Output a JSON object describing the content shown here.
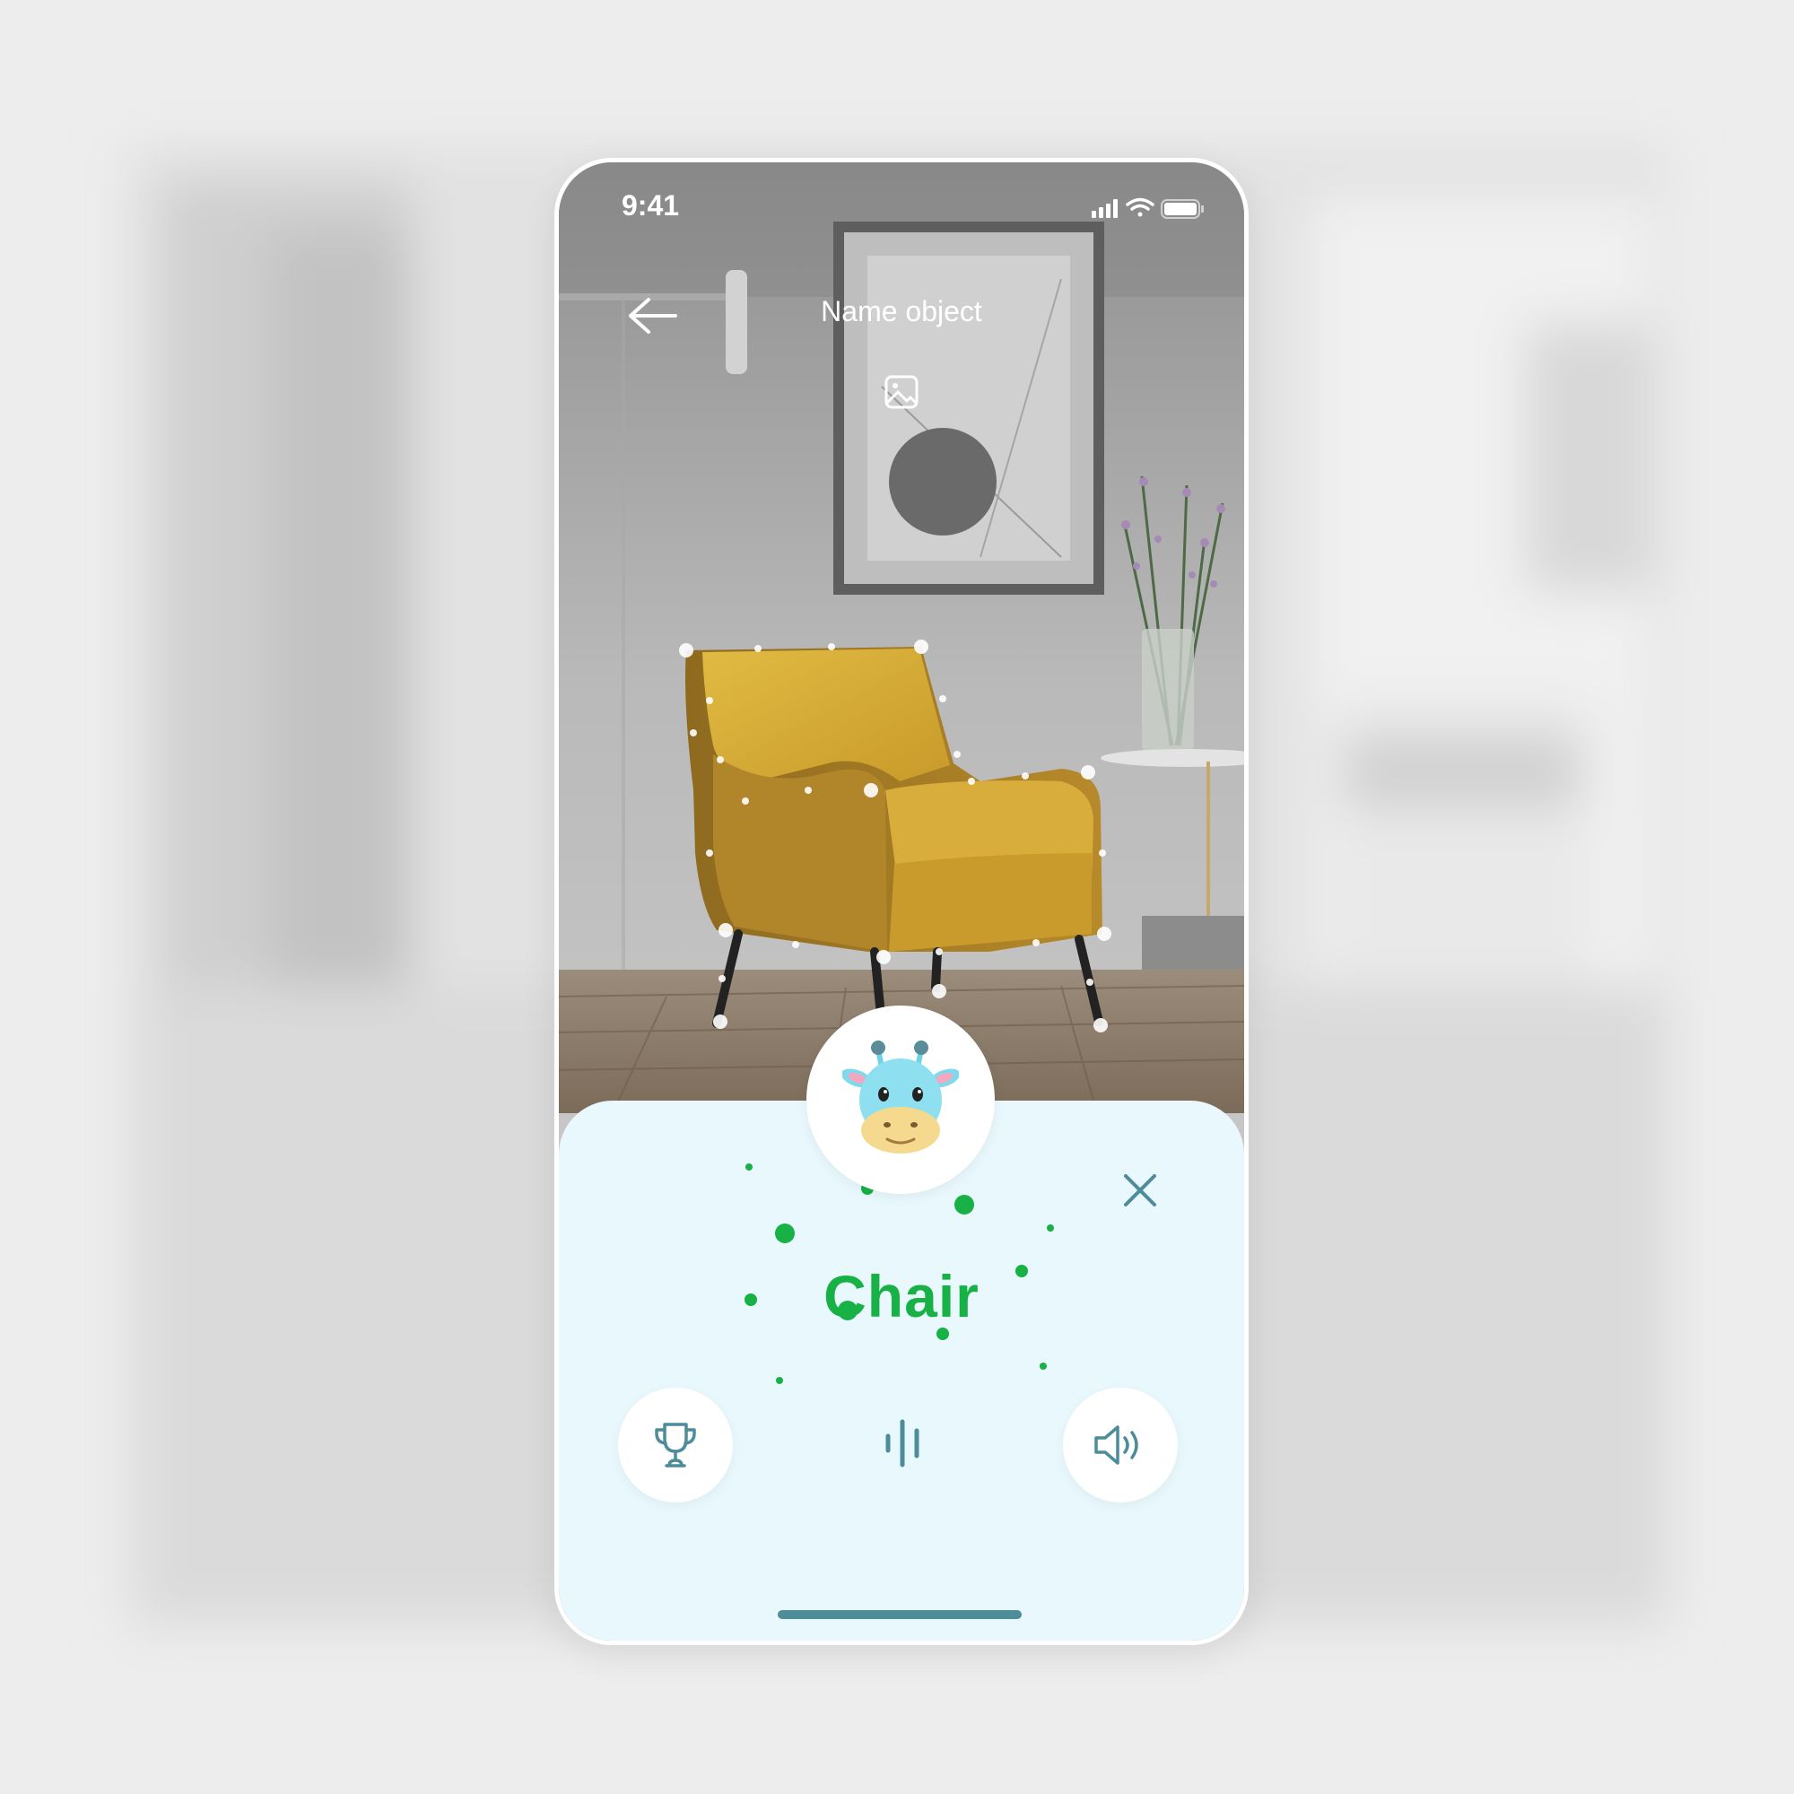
{
  "status_bar": {
    "time": "9:41",
    "icons": [
      "signal-icon",
      "wifi-icon",
      "battery-icon"
    ]
  },
  "header": {
    "title": "Name object",
    "back_icon": "arrow-left-icon",
    "gallery_icon": "image-icon"
  },
  "result": {
    "word": "Chair",
    "mascot": "giraffe-avatar"
  },
  "actions": {
    "left_icon": "trophy-icon",
    "center_icon": "voice-wave-icon",
    "right_icon": "speaker-icon",
    "close_icon": "close-icon"
  },
  "colors": {
    "accent_green": "#17b145",
    "sheet_background": "#e8f8fd",
    "icon_teal": "#4d8c99",
    "chair_yellow": "#d8b33a"
  }
}
